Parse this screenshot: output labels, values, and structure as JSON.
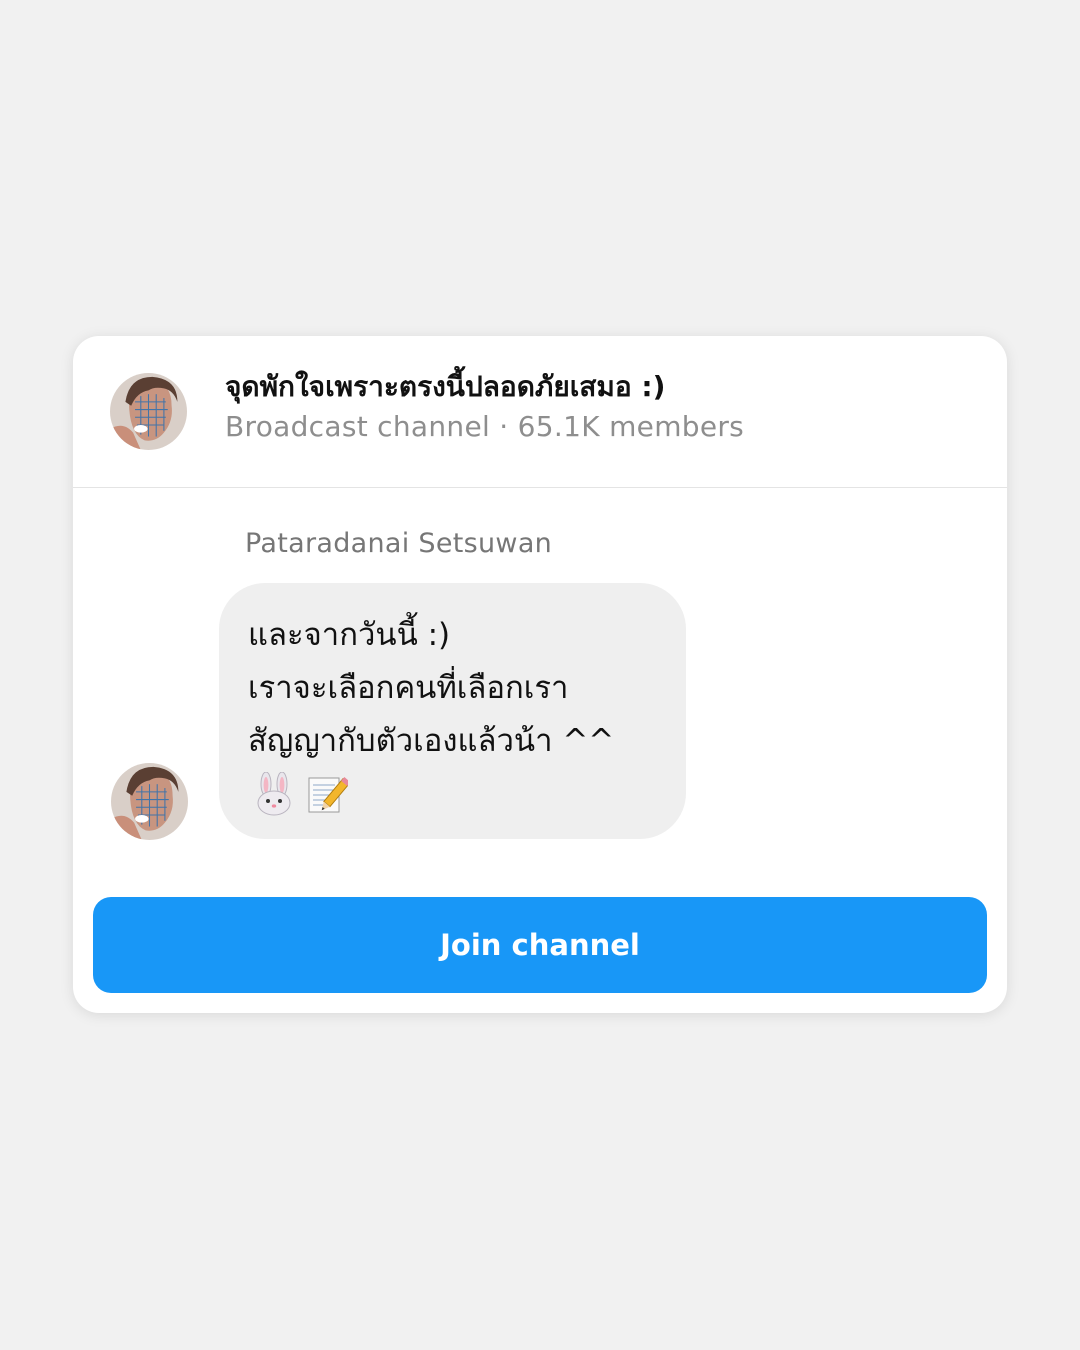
{
  "header": {
    "channel_name": "จุดพักใจเพราะตรงนี้ปลอดภัยเสมอ :)",
    "channel_meta": "Broadcast channel · 65.1K members"
  },
  "message": {
    "sender": "Pataradanai Setsuwan",
    "lines": [
      "และจากวันนี้ :)",
      "เราจะเลือกคนที่เลือกเรา",
      "สัญญากับตัวเองแล้วน้า ^^"
    ],
    "emojis": [
      "rabbit-face-icon",
      "memo-icon"
    ]
  },
  "actions": {
    "join_label": "Join channel"
  },
  "colors": {
    "background": "#f1f1f1",
    "card": "#ffffff",
    "bubble": "#efefef",
    "accent": "#1897f7",
    "muted_text": "#8e8e8e"
  }
}
